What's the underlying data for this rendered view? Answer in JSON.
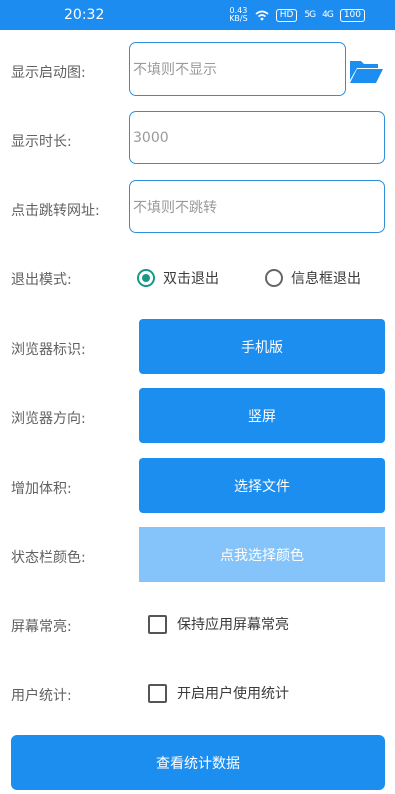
{
  "statusbar": {
    "time": "20:32",
    "speed_top": "0.43",
    "speed_bottom": "KB/S",
    "hd": "HD",
    "sig1": "5G",
    "sig2": "4G",
    "battery": "100"
  },
  "form": {
    "splash_label": "显示启动图:",
    "splash_placeholder": "不填则不显示",
    "duration_label": "显示时长:",
    "duration_placeholder": "3000",
    "url_label": "点击跳转网址:",
    "url_placeholder": "不填则不跳转",
    "exit_label": "退出模式:",
    "exit_options": [
      {
        "label": "双击退出",
        "checked": true
      },
      {
        "label": "信息框退出",
        "checked": false
      }
    ],
    "ua_label": "浏览器标识:",
    "ua_button": "手机版",
    "orientation_label": "浏览器方向:",
    "orientation_button": "竖屏",
    "size_label": "增加体积:",
    "size_button": "选择文件",
    "statusbar_color_label": "状态栏颜色:",
    "statusbar_color_button": "点我选择颜色",
    "keep_on_label": "屏幕常亮:",
    "keep_on_check": "保持应用屏幕常亮",
    "stats_label": "用户统计:",
    "stats_check": "开启用户使用统计",
    "view_stats_button": "查看统计数据"
  },
  "colors": {
    "primary": "#1c8ef0",
    "primary_light": "#85c4fb",
    "radio_accent": "#169a86",
    "input_border": "#2f8fd8"
  },
  "icons": {
    "folder": "folder-open-icon",
    "wifi": "wifi-icon",
    "battery": "battery-icon"
  }
}
